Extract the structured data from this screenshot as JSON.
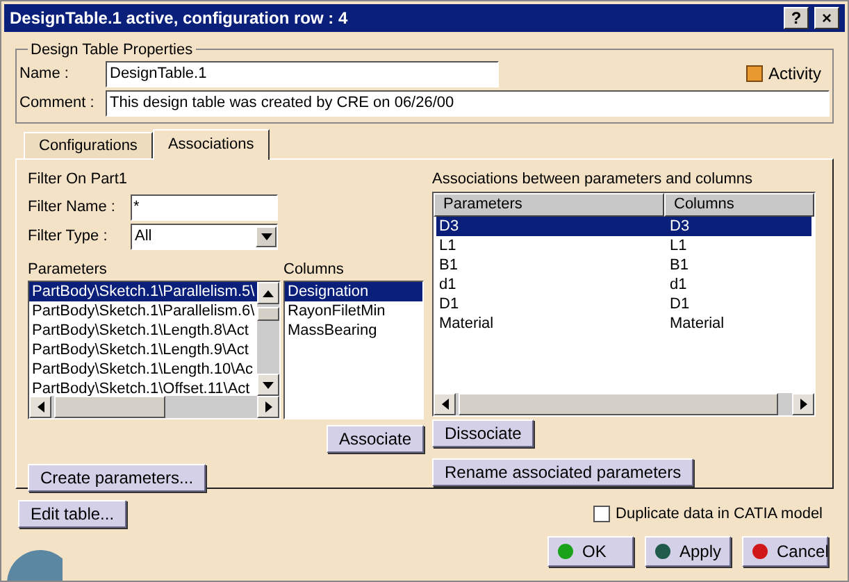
{
  "window": {
    "title": "DesignTable.1 active, configuration row : 4",
    "title_buttons": [
      "?",
      "×"
    ]
  },
  "properties": {
    "legend": "Design Table Properties",
    "name_label": "Name :",
    "name_value": "DesignTable.1",
    "comment_label": "Comment :",
    "comment_value": "This design table was created by CRE on 06/26/00",
    "activity": {
      "label": "Activity",
      "checked": true
    }
  },
  "tabs": [
    {
      "label": "Configurations",
      "selected": false
    },
    {
      "label": "Associations",
      "selected": true
    }
  ],
  "filter": {
    "title": "Filter On Part1",
    "name_label": "Filter Name :",
    "name_value": "*",
    "type_label": "Filter Type :",
    "type_value": "All"
  },
  "parameters": {
    "label": "Parameters",
    "items": [
      {
        "text": "PartBody\\Sketch.1\\Parallelism.5\\",
        "selected": true
      },
      {
        "text": "PartBody\\Sketch.1\\Parallelism.6\\",
        "selected": false
      },
      {
        "text": "PartBody\\Sketch.1\\Length.8\\Act",
        "selected": false
      },
      {
        "text": "PartBody\\Sketch.1\\Length.9\\Act",
        "selected": false
      },
      {
        "text": "PartBody\\Sketch.1\\Length.10\\Ac",
        "selected": false
      },
      {
        "text": "PartBody\\Sketch.1\\Offset.11\\Act",
        "selected": false
      }
    ]
  },
  "columns": {
    "label": "Columns",
    "items": [
      {
        "text": "Designation",
        "selected": true
      },
      {
        "text": "RayonFiletMin",
        "selected": false
      },
      {
        "text": "MassBearing",
        "selected": false
      }
    ]
  },
  "associate_button": "Associate",
  "create_button": "Create parameters...",
  "associations": {
    "label": "Associations between parameters and columns",
    "headers": [
      "Parameters",
      "Columns"
    ],
    "rows": [
      {
        "cells": [
          "D3",
          "D3"
        ],
        "selected": true
      },
      {
        "cells": [
          "L1",
          "L1"
        ],
        "selected": false
      },
      {
        "cells": [
          "B1",
          "B1"
        ],
        "selected": false
      },
      {
        "cells": [
          "d1",
          "d1"
        ],
        "selected": false
      },
      {
        "cells": [
          "D1",
          "D1"
        ],
        "selected": false
      },
      {
        "cells": [
          "Material",
          "Material"
        ],
        "selected": false
      }
    ]
  },
  "dissociate_button": "Dissociate",
  "rename_button": "Rename associated parameters",
  "edit_button": "Edit table...",
  "duplicate": {
    "label": "Duplicate data in CATIA model",
    "checked": false
  },
  "actions": [
    {
      "label": "OK",
      "kind": "ok"
    },
    {
      "label": "Apply",
      "kind": "apply"
    },
    {
      "label": "Cancel",
      "kind": "cancel"
    }
  ]
}
